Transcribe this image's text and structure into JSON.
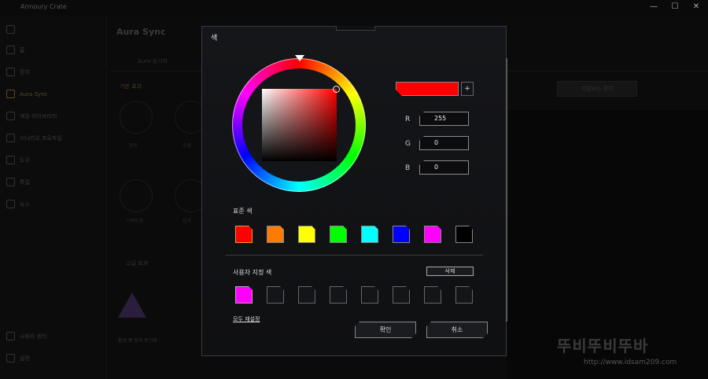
{
  "app": {
    "title": "Armoury Crate",
    "window_controls": {
      "minimize": "—",
      "maximize": "☐",
      "close": "✕"
    },
    "sidebar": {
      "items": [
        {
          "label": "홈"
        },
        {
          "label": "장치"
        },
        {
          "label": "Aura Sync"
        },
        {
          "label": "게임 라이브러리"
        },
        {
          "label": "시나리오 프로파일"
        },
        {
          "label": "도구"
        },
        {
          "label": "특집"
        },
        {
          "label": "뉴스"
        }
      ],
      "bottom_items": [
        {
          "label": "사용자 센터"
        },
        {
          "label": "설정"
        }
      ]
    },
    "main": {
      "title": "Aura Sync",
      "tab": "Aura 동기화",
      "section": "기본 효과",
      "button": "지원되는 장치",
      "effects": [
        {
          "label": "정적"
        },
        {
          "label": "호흡"
        },
        {
          "label": "스펙트럼"
        },
        {
          "label": "음악"
        }
      ],
      "advanced": "고급 효과",
      "bottom_text": "활성 중 장치 동기화"
    },
    "watermark": {
      "text": "뚜비뚜비뚜바",
      "url": "http://www.idsam209.com"
    }
  },
  "dialog": {
    "title": "색",
    "current_color": "#ff0000",
    "add_button": "+",
    "rgb": {
      "r_label": "R",
      "r_value": "255",
      "g_label": "G",
      "g_value": "0",
      "b_label": "B",
      "b_value": "0"
    },
    "standard_label": "표준 색",
    "standard_colors": [
      "#ff0000",
      "#ff7a00",
      "#ffff00",
      "#00ff00",
      "#00ffff",
      "#0000ff",
      "#ff00ff",
      "#000000"
    ],
    "selected_standard_index": 0,
    "custom_label": "사용자 지정 색",
    "delete_button": "삭제",
    "custom_colors": [
      "#ff00ff",
      "",
      "",
      "",
      "",
      "",
      "",
      ""
    ],
    "reset_link": "모두 재설정",
    "ok_button": "확인",
    "cancel_button": "취소"
  }
}
